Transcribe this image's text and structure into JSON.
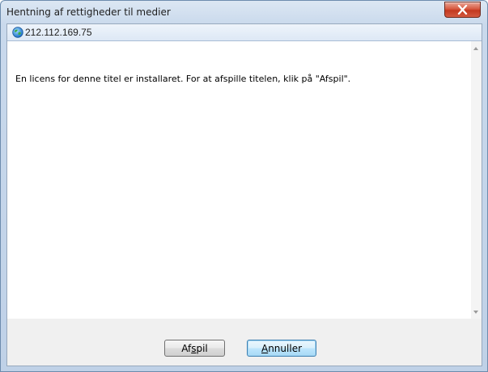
{
  "window": {
    "title": "Hentning af rettigheder til medier",
    "close_label": "X"
  },
  "addressbar": {
    "icon": "globe-icon",
    "address": "212.112.169.75"
  },
  "content": {
    "message": "En licens for denne titel er installaret. For at afspille titelen, klik på \"Afspil\"."
  },
  "buttons": {
    "play_pre": "Af",
    "play_accel": "s",
    "play_post": "pil",
    "cancel_accel": "A",
    "cancel_post": "nnuller"
  },
  "colors": {
    "frame": "#bfd1e7",
    "close_button": "#c3391f",
    "default_button_border": "#3c7fb1"
  }
}
